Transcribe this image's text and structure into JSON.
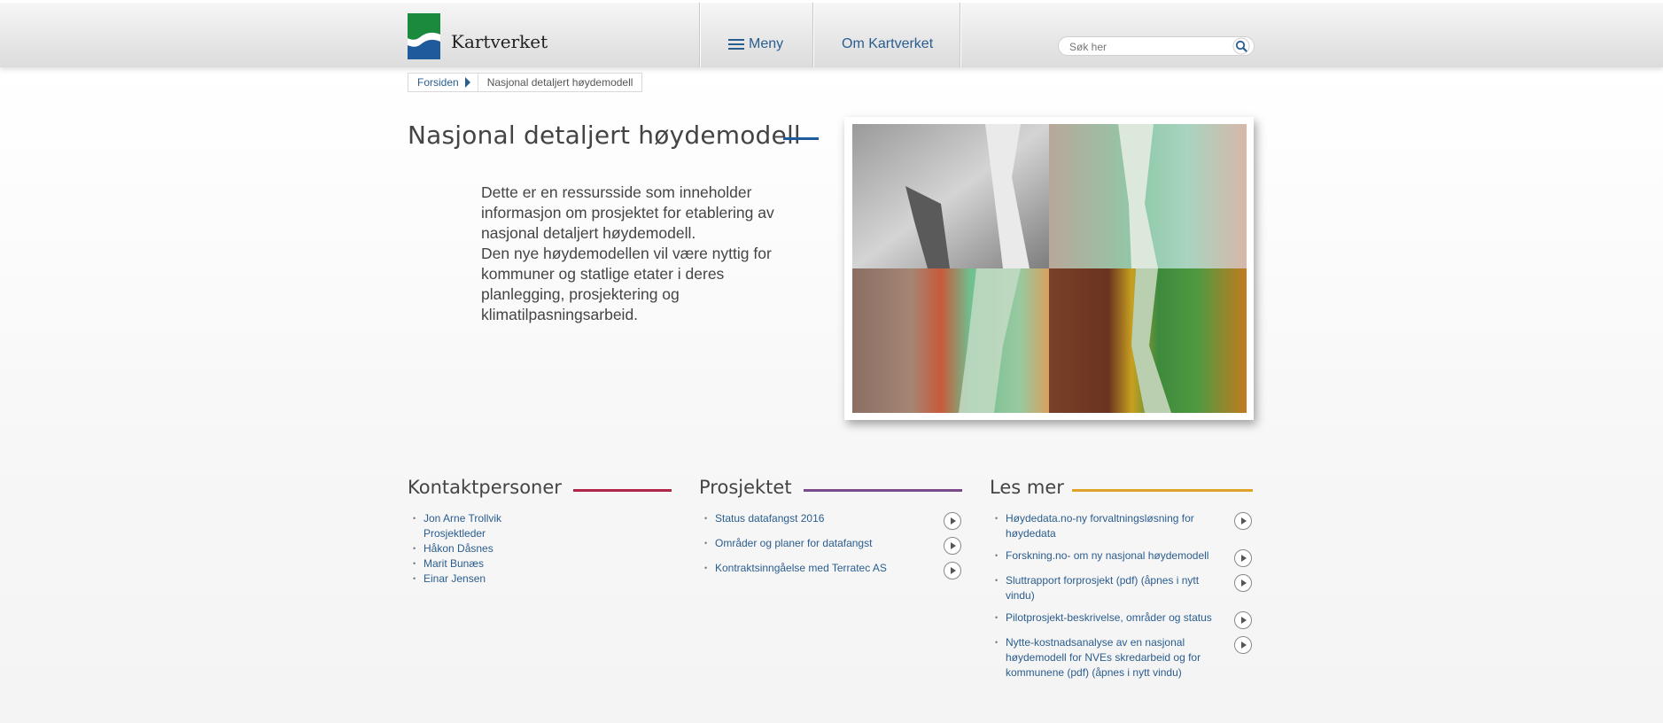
{
  "header": {
    "logo_text": "Kartverket",
    "menu_label": "Meny",
    "about_label": "Om Kartverket",
    "search_placeholder": "Søk her"
  },
  "breadcrumb": {
    "home": "Forsiden",
    "current": "Nasjonal detaljert høydemodell"
  },
  "hero": {
    "title": "Nasjonal detaljert høydemodell",
    "paragraph1": "Dette er en ressursside som inneholder informasjon om prosjektet for etablering av nasjonal detaljert høydemodell.",
    "paragraph2": "Den nye høydemodellen vil være nyttig for kommuner og statlige etater i deres planlegging, prosjektering og klimatilpasningsarbeid."
  },
  "contacts": {
    "title": "Kontaktpersoner",
    "accent": "#b0264a",
    "items": [
      {
        "name": "Jon Arne Trollvik",
        "role": "Prosjektleder"
      },
      {
        "name": "Håkon Dåsnes"
      },
      {
        "name": "Marit Bunæs"
      },
      {
        "name": "Einar Jensen"
      }
    ]
  },
  "project": {
    "title": "Prosjektet",
    "accent": "#7a4a8c",
    "items": [
      {
        "label": "Status datafangst 2016"
      },
      {
        "label": "Områder og planer for datafangst"
      },
      {
        "label": "Kontraktsinngåelse med Terratec AS"
      }
    ]
  },
  "read_more": {
    "title": "Les mer",
    "accent": "#e0a32a",
    "items": [
      {
        "label": "Høydedata.no-ny forvaltningsløsning for høydedata"
      },
      {
        "label": "Forskning.no- om ny nasjonal høydemodell"
      },
      {
        "label": "Sluttrapport forprosjekt (pdf) (åpnes i nytt vindu)"
      },
      {
        "label": "Pilotprosjekt-beskrivelse, områder og status"
      },
      {
        "label": "Nytte-kostnadsanalyse av en nasjonal høydemodell for NVEs skredarbeid og for kommunene (pdf) (åpnes i nytt vindu)"
      }
    ]
  },
  "colors": {
    "link": "#2a5d8f",
    "logo_green": "#1a8a3c",
    "logo_blue": "#1e5a9c",
    "hero_accent": "#1e5a9c"
  }
}
